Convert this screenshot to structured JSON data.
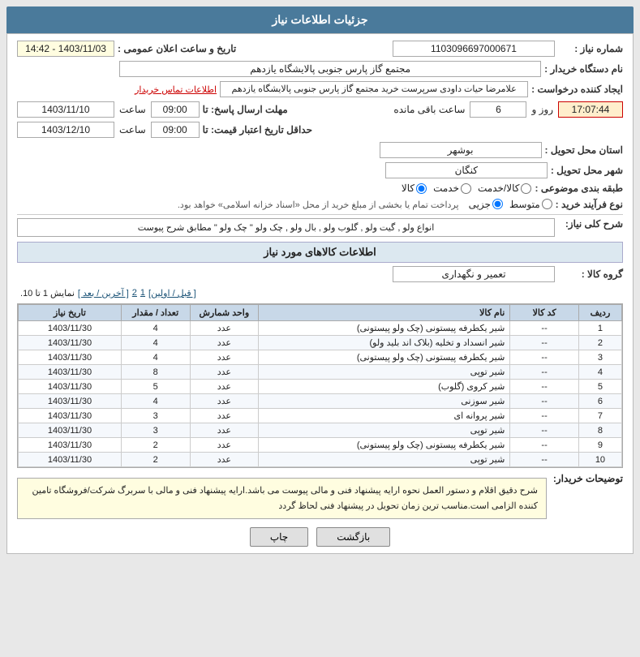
{
  "header": {
    "title": "جزئیات اطلاعات نیاز"
  },
  "fields": {
    "need_number_label": "شماره نیاز :",
    "need_number_value": "1103096697000671",
    "date_label": "تاریخ و ساعت اعلان عمومی :",
    "date_value": "1403/11/03 - 14:42",
    "buyer_label": "نام دستگاه خریدار :",
    "buyer_value": "مجتمع گاز پارس جنوبی  پالایشگاه یازدهم",
    "requester_label": "ایجاد کننده درخواست :",
    "requester_value": "علامرضا حیات داودی سرپرست خرید مجتمع گاز پارس جنوبی  پالایشگاه یازدهم",
    "contact_link": "اطلاعات تماس خریدار",
    "reply_deadline_label": "مهلت ارسال پاسخ: تا",
    "reply_date": "1403/11/10",
    "reply_time": "09:00",
    "reply_days": "6",
    "reply_remaining": "17:07:44",
    "reply_remaining_label": "روز و",
    "reply_remaining_suffix": "ساعت باقی مانده",
    "price_deadline_label": "حداقل تاریخ اعتبار قیمت: تا",
    "price_date": "1403/12/10",
    "price_time": "09:00",
    "province_label": "استان محل تحویل :",
    "province_value": "بوشهر",
    "city_label": "شهر محل تحویل :",
    "city_value": "کنگان",
    "category_label": "طبقه بندی موضوعی :",
    "category_kala": "کالا",
    "category_khadamat": "خدمت",
    "category_kala_khadamat": "کالا/خدمت",
    "purchase_type_label": "نوع فرآیند خرید :",
    "purchase_type_partial": "جزیی",
    "purchase_type_medium": "متوسط",
    "purchase_note": "پرداخت تمام یا بخشی از مبلغ خرید از محل «اسناد خزانه اسلامی» خواهد بود.",
    "srh_label": "شرح کلی نیاز:",
    "srh_value": "انواع ولو , گیت ولو , گلوب ولو , بال ولو , چک ولو \" چک ولو \" مطابق شرح پیوست",
    "items_section_label": "اطلاعات کالاهای مورد نیاز",
    "group_label": "گروه کالا :",
    "group_value": "تعمیر و نگهداری",
    "paging_label": "نمایش 1 تا 10.",
    "paging_next": "[ آخرین / بعد ]",
    "paging_2": "2",
    "paging_1": "1",
    "paging_prev": "[ قبل / اولین]",
    "col_row": "ردیف",
    "col_code": "کد کالا",
    "col_name": "نام کالا",
    "col_unit_label": "واحد شمارش",
    "col_qty": "تعداد / مقدار",
    "col_date": "تاریخ نیاز",
    "table_rows": [
      {
        "row": "1",
        "code": "--",
        "name": "شیر یکطرفه پیستونی (چک ولو پیستونی)",
        "unit": "عدد",
        "qty": "4",
        "date": "1403/11/30"
      },
      {
        "row": "2",
        "code": "--",
        "name": "شیر انسداد و تخلیه (بلاک اند بلید ولو)",
        "unit": "عدد",
        "qty": "4",
        "date": "1403/11/30"
      },
      {
        "row": "3",
        "code": "--",
        "name": "شیر یکطرفه پیستونی (چک ولو پیستونی)",
        "unit": "عدد",
        "qty": "4",
        "date": "1403/11/30"
      },
      {
        "row": "4",
        "code": "--",
        "name": "شیر توپی",
        "unit": "عدد",
        "qty": "8",
        "date": "1403/11/30"
      },
      {
        "row": "5",
        "code": "--",
        "name": "شیر کروی (گلوب)",
        "unit": "عدد",
        "qty": "5",
        "date": "1403/11/30"
      },
      {
        "row": "6",
        "code": "--",
        "name": "شیر سوزنی",
        "unit": "عدد",
        "qty": "4",
        "date": "1403/11/30"
      },
      {
        "row": "7",
        "code": "--",
        "name": "شیر پروانه ای",
        "unit": "عدد",
        "qty": "3",
        "date": "1403/11/30"
      },
      {
        "row": "8",
        "code": "--",
        "name": "شیر توپی",
        "unit": "عدد",
        "qty": "3",
        "date": "1403/11/30"
      },
      {
        "row": "9",
        "code": "--",
        "name": "شیر یکطرفه پیستونی (چک ولو پیستونی)",
        "unit": "عدد",
        "qty": "2",
        "date": "1403/11/30"
      },
      {
        "row": "10",
        "code": "--",
        "name": "شیر توپی",
        "unit": "عدد",
        "qty": "2",
        "date": "1403/11/30"
      }
    ],
    "notes_label": "توضیحات خریدار:",
    "notes_value": "شرح دقیق اقلام و دستور العمل نحوه ارایه پیشنهاد فنی و مالی پیوست می باشد.ارایه پیشنهاد فنی و مالی با سربرگ شرکت/فروشگاه تامین کننده الزامی است.مناسب ترین زمان تحویل در پیشنهاد فنی لحاظ گردد",
    "btn_print": "چاپ",
    "btn_back": "بازگشت"
  }
}
